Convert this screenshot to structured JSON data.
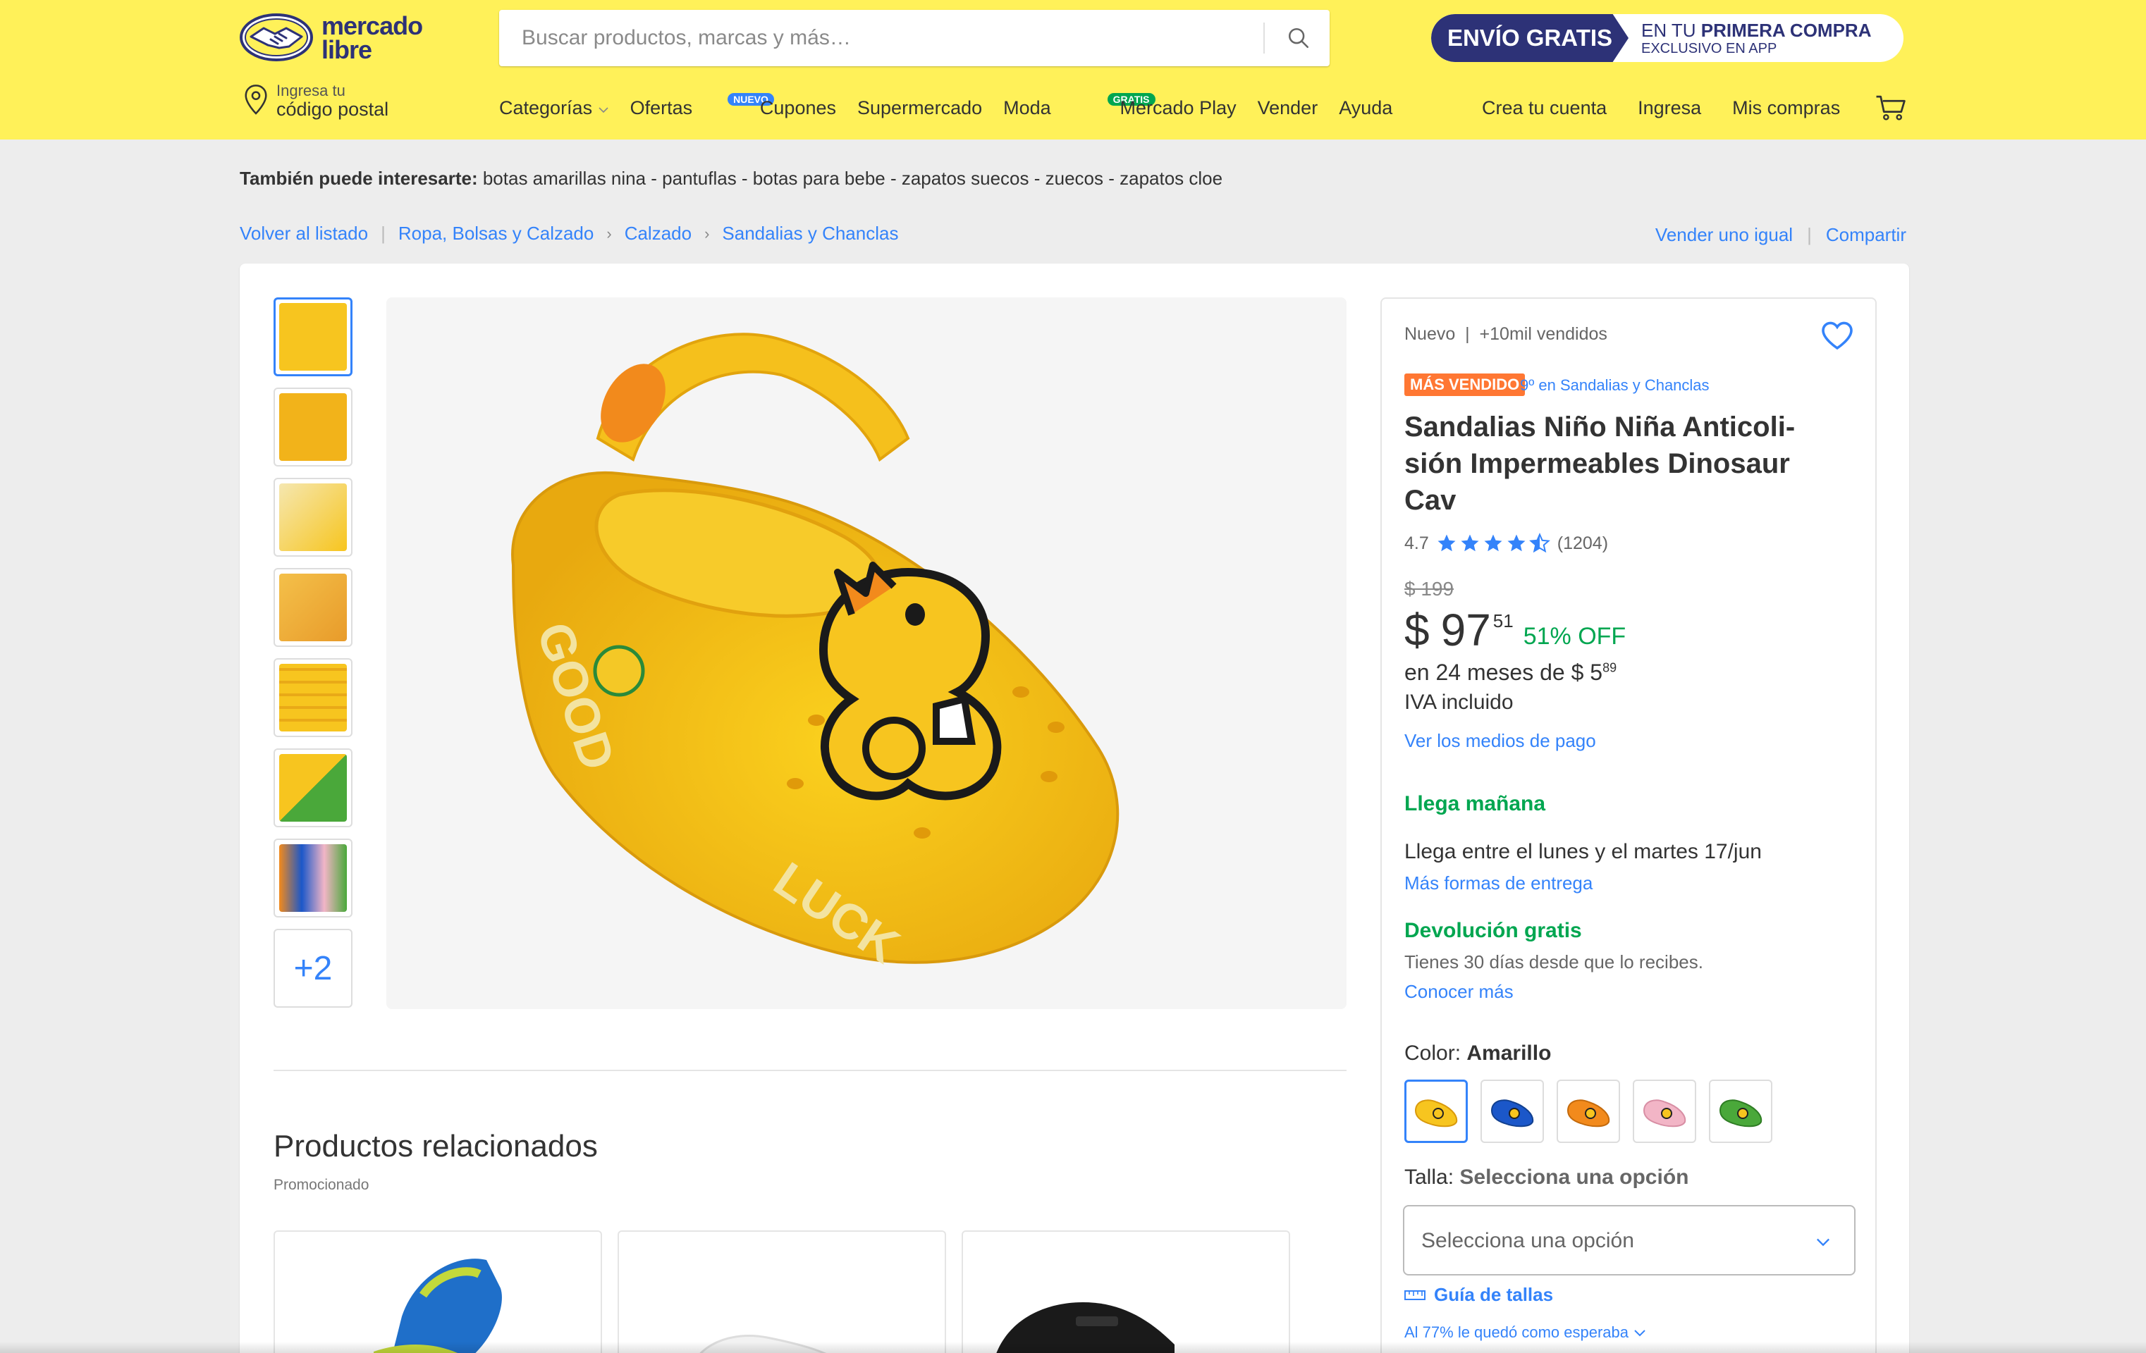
{
  "header": {
    "logo_text": "mercado libre",
    "search_placeholder": "Buscar productos, marcas y más…",
    "promo": {
      "badge": "ENVÍO GRATIS",
      "line1_prefix": "EN TU ",
      "line1_bold": "PRIMERA COMPRA",
      "line2": "EXCLUSIVO EN APP"
    },
    "location": {
      "line1": "Ingresa tu",
      "line2": "código postal"
    },
    "nav": [
      {
        "label": "Categorías",
        "badge": ""
      },
      {
        "label": "Ofertas",
        "badge": ""
      },
      {
        "label": "Cupones",
        "badge": "NUEVO"
      },
      {
        "label": "Supermercado",
        "badge": ""
      },
      {
        "label": "Moda",
        "badge": ""
      },
      {
        "label": "Mercado Play",
        "badge": "GRATIS"
      },
      {
        "label": "Vender",
        "badge": ""
      },
      {
        "label": "Ayuda",
        "badge": ""
      }
    ],
    "account": [
      "Crea tu cuenta",
      "Ingresa",
      "Mis compras"
    ]
  },
  "interest": {
    "label": "También puede interesarte:",
    "items": "botas amarillas nina - pantuflas - botas para bebe - zapatos suecos - zuecos - zapatos cloe"
  },
  "breadcrumb": {
    "back": "Volver al listado",
    "path": [
      "Ropa, Bolsas y Calzado",
      "Calzado",
      "Sandalias y Chanclas"
    ],
    "sell_same": "Vender uno igual",
    "share": "Compartir"
  },
  "gallery": {
    "more_label": "+2"
  },
  "related": {
    "title": "Productos relacionados",
    "subtitle": "Promocionado"
  },
  "product": {
    "condition": "Nuevo",
    "sold": "+10mil vendidos",
    "badge": "MÁS VENDIDO",
    "rank": "9º en Sandalias y Chanclas",
    "title_lines": [
      "Sandalias Niño Niña Anticoli-",
      "sión Impermeables Dinosaur",
      "Cav"
    ],
    "rating": 4.7,
    "rating_text": "4.7",
    "reviews": "(1204)",
    "old_price": "$ 199",
    "price_currency": "$",
    "price_int": "97",
    "price_cents": "51",
    "discount": "51% OFF",
    "installments_prefix": "en 24 meses de $ 5",
    "installments_cents": "89",
    "iva": "IVA incluido",
    "payment_link": "Ver los medios de pago",
    "delivery_title": "Llega mañana",
    "delivery_text": "Llega entre el lunes y el martes 17/jun",
    "delivery_link": "Más formas de entrega",
    "return_title": "Devolución gratis",
    "return_text": "Tienes 30 días desde que lo recibes.",
    "return_link": "Conocer más",
    "color_label": "Color:",
    "color_value": "Amarillo",
    "colors": [
      "#f7c51f",
      "#1b57c9",
      "#f28a1c",
      "#f2b5c6",
      "#4aa83a"
    ],
    "size_label": "Talla:",
    "size_value": "Selecciona una opción",
    "size_placeholder": "Selecciona una opción",
    "size_guide": "Guía de tallas",
    "fit_text": "Al 77% le quedó como esperaba"
  },
  "colors": {
    "header_yellow": "#fff159",
    "brand_blue": "#2d3277",
    "link_blue": "#3483fa",
    "green": "#00a650",
    "orange_badge": "#ff7733"
  }
}
